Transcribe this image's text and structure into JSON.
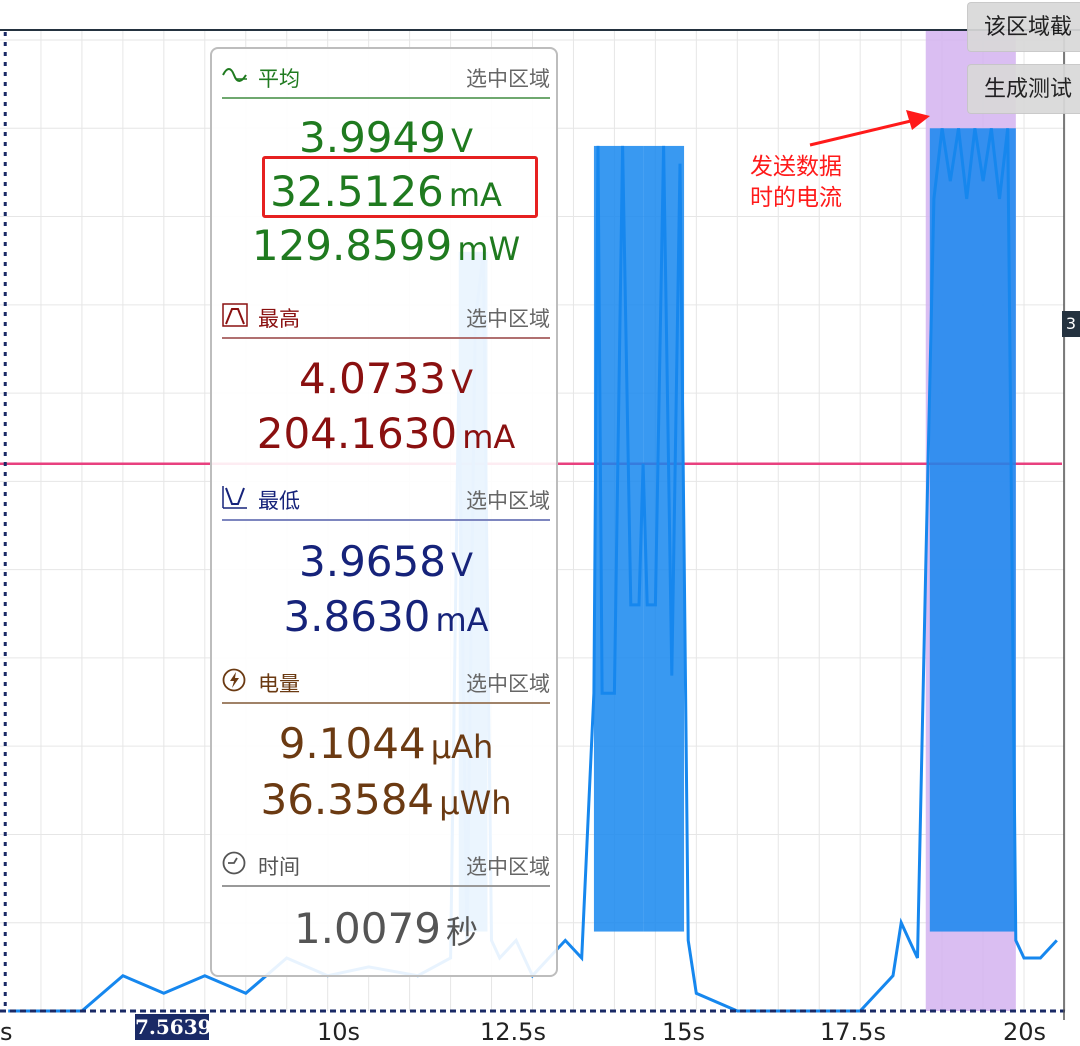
{
  "chart_data": {
    "type": "line",
    "title": "",
    "xlabel": "",
    "ylabel": "",
    "x_ticks": [
      "s",
      "10s",
      "12.5s",
      "15s",
      "17.5s",
      "20s"
    ],
    "xlim": [
      7.5,
      20.5
    ],
    "cursor_x": 7.5639,
    "cursor_label": "7.5639",
    "threshold_marker_label": "3",
    "selected_region": [
      18.8,
      19.9
    ],
    "series": [
      {
        "color": "#1687ee",
        "x": [
          7.6,
          8.5,
          9.0,
          9.5,
          10.0,
          10.5,
          11.0,
          11.5,
          12.0,
          12.6,
          13.0,
          13.1,
          13.2,
          13.3,
          13.4,
          13.5,
          13.6,
          13.8,
          14.0,
          14.2,
          14.4,
          14.6,
          14.75,
          14.8,
          14.85,
          15.0,
          15.1,
          15.2,
          15.3,
          15.35,
          15.4,
          15.5,
          15.6,
          15.7,
          15.8,
          15.9,
          16.0,
          16.5,
          17.0,
          17.5,
          18.0,
          18.4,
          18.5,
          18.6,
          18.7,
          18.8,
          18.9,
          19.0,
          19.1,
          19.2,
          19.3,
          19.4,
          19.5,
          19.6,
          19.7,
          19.8,
          19.9,
          20.0,
          20.2,
          20.4
        ],
        "y": [
          0.0,
          0.0,
          0.2,
          0.1,
          0.2,
          0.1,
          0.3,
          0.2,
          0.25,
          0.2,
          0.3,
          3.6,
          0.4,
          3.9,
          4.3,
          0.4,
          0.3,
          0.4,
          0.2,
          0.3,
          0.4,
          0.3,
          1.8,
          4.9,
          1.8,
          1.8,
          4.9,
          2.3,
          2.3,
          3.1,
          2.3,
          2.3,
          4.9,
          1.9,
          4.8,
          0.4,
          0.1,
          0.0,
          0.0,
          0.0,
          0.0,
          0.2,
          0.5,
          0.4,
          0.3,
          2.5,
          4.6,
          5.0,
          4.7,
          5.0,
          4.6,
          5.0,
          4.7,
          5.0,
          4.6,
          5.0,
          0.4,
          0.3,
          0.3,
          0.4
        ]
      }
    ],
    "threshold_y": 3.1,
    "ylim": [
      0,
      5.5
    ]
  },
  "toolbar": {
    "screenshot_button": "该区域截",
    "report_button": "生成测试"
  },
  "annotation": {
    "line1": "发送数据",
    "line2": "时的电流"
  },
  "panel": {
    "average": {
      "title": "平均",
      "scope": "选中区域",
      "voltage": "3.9949",
      "voltage_unit": "V",
      "current": "32.5126",
      "current_unit": "mA",
      "power": "129.8599",
      "power_unit": "mW",
      "color": "#1f7a1f"
    },
    "max": {
      "title": "最高",
      "scope": "选中区域",
      "voltage": "4.0733",
      "voltage_unit": "V",
      "current": "204.1630",
      "current_unit": "mA",
      "color": "#8a1010"
    },
    "min": {
      "title": "最低",
      "scope": "选中区域",
      "voltage": "3.9658",
      "voltage_unit": "V",
      "current": "3.8630",
      "current_unit": "mA",
      "color": "#16237a"
    },
    "energy": {
      "title": "电量",
      "scope": "选中区域",
      "charge": "9.1044",
      "charge_unit": "μAh",
      "energy": "36.3584",
      "energy_unit": "μWh",
      "color": "#6b3a12"
    },
    "time": {
      "title": "时间",
      "scope": "选中区域",
      "duration": "1.0079",
      "duration_unit": "秒",
      "color": "#555555"
    }
  }
}
